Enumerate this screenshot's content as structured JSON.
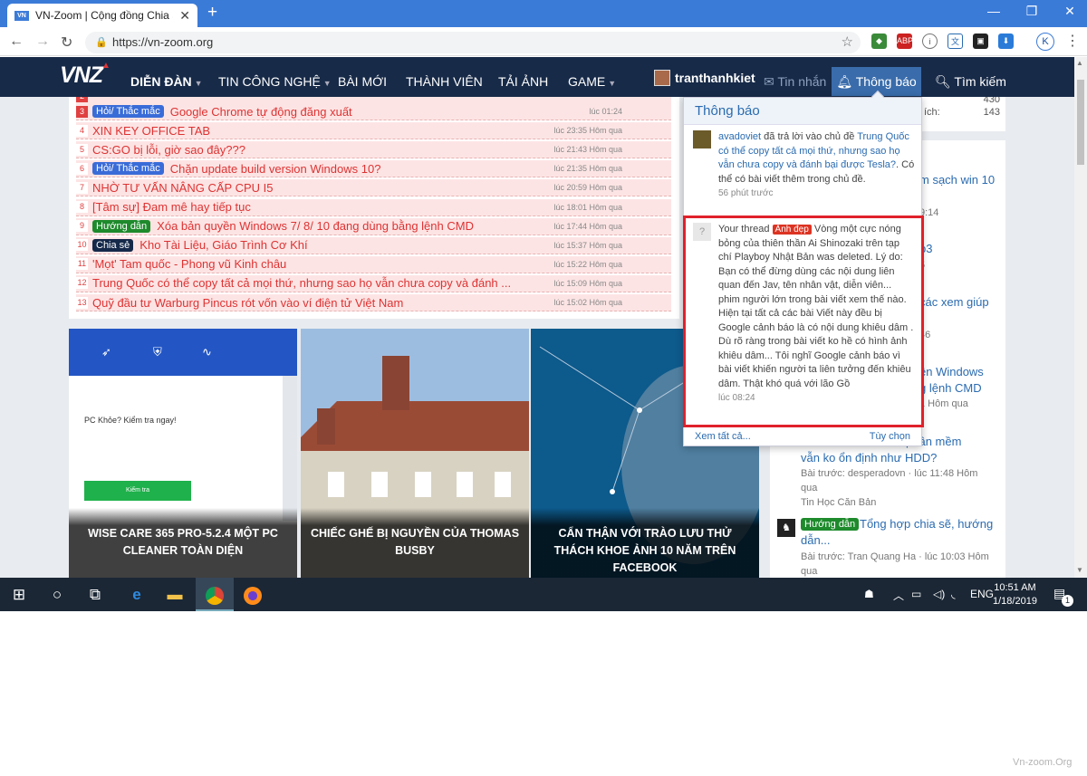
{
  "browser": {
    "tab_title": "VN-Zoom | Cộng đồng Chia Sẻ Kiến Thức",
    "favicon": "VN",
    "url": "https://vn-zoom.org",
    "avatar_letter": "K"
  },
  "nav": {
    "logo": "VNZ",
    "items": [
      "DIỄN ĐÀN",
      "TIN CÔNG NGHỆ",
      "BÀI MỚI",
      "THÀNH VIÊN",
      "TẢI ẢNH",
      "GAME"
    ],
    "username": "tranthanhkiet",
    "messages": "Tin nhắn",
    "notifications": "Thông báo",
    "search": "Tìm kiếm"
  },
  "threads": [
    {
      "n": "3",
      "tag": "Hỏi/ Thắc mắc",
      "tag_color": "#3a6cd8",
      "title": "Google Chrome tự động đăng xuất",
      "time": "lúc 01:24"
    },
    {
      "n": "4",
      "tag": "",
      "tag_color": "",
      "title": "XIN KEY OFFICE TAB",
      "time": "lúc 23:35 Hôm qua"
    },
    {
      "n": "5",
      "tag": "",
      "tag_color": "",
      "title": "CS:GO bị lỗi, giờ sao đây???",
      "time": "lúc 21:43 Hôm qua"
    },
    {
      "n": "6",
      "tag": "Hỏi/ Thắc mắc",
      "tag_color": "#3a6cd8",
      "title": "Chặn update build version Windows 10?",
      "time": "lúc 21:35 Hôm qua"
    },
    {
      "n": "7",
      "tag": "",
      "tag_color": "",
      "title": "NHỜ TƯ VẤN NÂNG CẤP CPU I5",
      "time": "lúc 20:59 Hôm qua"
    },
    {
      "n": "8",
      "tag": "",
      "tag_color": "",
      "title": "[Tâm sự] Đam mê hay tiếp tục",
      "time": "lúc 18:01 Hôm qua"
    },
    {
      "n": "9",
      "tag": "Hướng dẫn",
      "tag_color": "#1e8a2c",
      "title": "Xóa bản quyền Windows 7/ 8/ 10 đang dùng bằng lệnh CMD",
      "time": "lúc 17:44 Hôm qua"
    },
    {
      "n": "10",
      "tag": "Chia sẻ",
      "tag_color": "#15294a",
      "title": "Kho Tài Liệu, Giáo Trình Cơ Khí",
      "time": "lúc 15:37 Hôm qua"
    },
    {
      "n": "11",
      "tag": "",
      "tag_color": "",
      "title": "'Mọt' Tam quốc - Phong vũ Kinh châu",
      "time": "lúc 15:22 Hôm qua"
    },
    {
      "n": "12",
      "tag": "",
      "tag_color": "",
      "title": "Trung Quốc có thể copy tất cả mọi thứ, nhưng sao họ vẫn chưa copy và đánh ...",
      "time": "lúc 15:09 Hôm qua"
    },
    {
      "n": "13",
      "tag": "",
      "tag_color": "",
      "title": "Quỹ đầu tư Warburg Pincus rót vốn vào ví điện tử Việt Nam",
      "time": "lúc 15:02 Hôm qua"
    }
  ],
  "cards": [
    {
      "caption": "WISE CARE 365 PRO-5.2.4 MỘT PC CLEANER TOÀN DIỆN",
      "panel_text": "PC Khỏe? Kiểm tra ngay!",
      "button": "Kiểm tra"
    },
    {
      "caption": "CHIẾC GHẾ BỊ NGUYỀN CỦA THOMAS BUSBY"
    },
    {
      "caption": "CẨN THẬN VỚI TRÀO LƯU THỬ THÁCH KHOE ẢNH 10 NĂM TRÊN FACEBOOK"
    }
  ],
  "stats": {
    "v1": "430",
    "label2": "ích:",
    "v2": "143"
  },
  "side": {
    "frag1": "m sạch win 10",
    "frag1_time": "9:14",
    "frag2": "p3",
    "frag2_time": "5",
    "frag3": "các xem giúp",
    "frag3_time": "46",
    "frag4": "ền Windows",
    "frag4b": "g lệnh CMD",
    "frag4_time": "1 Hôm qua",
    "frag5": "phần mềm",
    "frag5b": "vẫn ko ổn định như HDD?",
    "frag5_meta": "Bài trước: desperadovn · lúc 11:48 Hôm",
    "frag5_meta2": "qua",
    "frag5_forum": "Tin Học Căn Bản",
    "item6_tag": "Hướng dẫn",
    "item6_title": "Tổng hợp chia sẽ, hướng",
    "item6_title2": "dẫn...",
    "item6_meta": "Bài trước: Tran Quang Ha · lúc 10:03 Hôm",
    "item6_meta2": "qua"
  },
  "notifications": {
    "header": "Thông báo",
    "n1_user": "avadoviet",
    "n1_action": "đã trả lời vào chủ đề",
    "n1_thread": "Trung Quốc có thể copy tất cả mọi thứ, nhưng sao họ vẫn chưa copy và đánh bại được Tesla?",
    "n1_rest": ". Có thể có bài viết thêm trong chủ đề.",
    "n1_time": "56 phút trước",
    "n2_prefix": "Your thread",
    "n2_tag": "Ảnh đẹp",
    "n2_body": "Vòng một cực nóng bỏng của thiên thần Ai Shinozaki trên tạp chí Playboy Nhật Bản was deleted. Lý do: Bạn có thể đừng dùng các nội dung liên quan đến Jav, tên nhân vật, diễn viên... phim người lớn trong bài viết xem thế nào. Hiện tại tất cả các bài Viết này đều bị Google cảnh báo là có nội dung khiêu dâm . Dù rõ ràng trong bài viết ko hề có hình ảnh khiêu dâm... Tôi nghĩ Google cảnh báo vì bài viết khiến người ta liên tưởng đến khiêu dâm. Thật khó quá với lão Gồ",
    "n2_time": "lúc 08:24",
    "see_all": "Xem tất cả...",
    "options": "Tùy chọn"
  },
  "taskbar": {
    "lang": "ENG",
    "time": "10:51 AM",
    "date": "1/18/2019",
    "notif_count": "1"
  },
  "watermark": "Vn-zoom.Org"
}
